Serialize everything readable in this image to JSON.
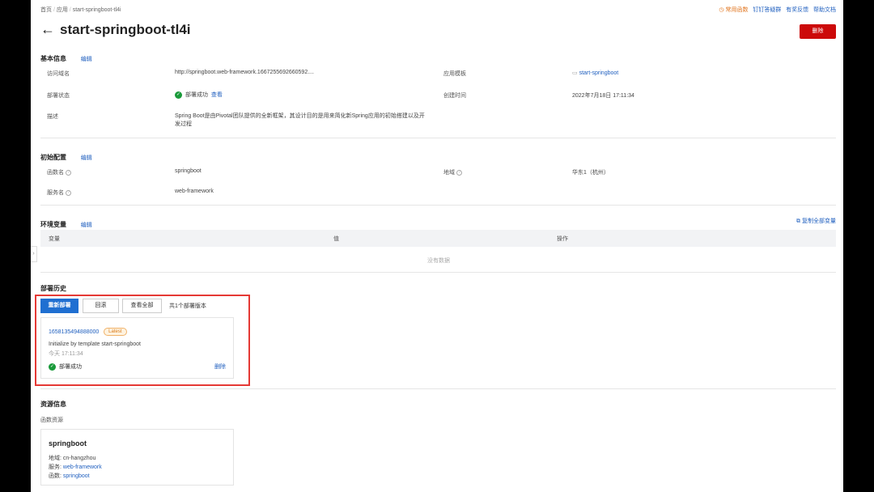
{
  "breadcrumb": [
    "首页",
    "应用",
    "start-springboot-tl4i"
  ],
  "toplinks": {
    "common_functions": "常用函数",
    "dingtalk": "钉钉答疑群",
    "feedback": "有奖反馈",
    "help": "帮助文档"
  },
  "header": {
    "title": "start-springboot-tl4i",
    "delete_label": "删除"
  },
  "basic": {
    "title": "基本信息",
    "edit": "编辑",
    "domain_label": "访问域名",
    "domain_value": "http://springboot.web-framework.1667255692660592....",
    "template_label": "应用模板",
    "template_value": "start-springboot",
    "status_label": "部署状态",
    "status_value": "部署成功",
    "status_view": "查看",
    "created_label": "创建时间",
    "created_value": "2022年7月18日 17:11:34",
    "desc_label": "描述",
    "desc_line1": "Spring Boot是由Pivotal团队提供的全新框架，其设计目的是用来简化新Spring应用的初始搭建以及开",
    "desc_line2": "发过程"
  },
  "init": {
    "title": "初始配置",
    "edit": "编辑",
    "func_label": "函数名",
    "func_value": "springboot",
    "region_label": "地域",
    "region_value": "华东1（杭州）",
    "service_label": "服务名",
    "service_value": "web-framework"
  },
  "env": {
    "title": "环境变量",
    "edit": "编辑",
    "copy_all": "复制全部变量",
    "col_var": "变量",
    "col_value": "值",
    "col_action": "操作",
    "empty": "没有数据"
  },
  "deploy": {
    "title": "部署历史",
    "redeploy": "重新部署",
    "rollback": "回滚",
    "view_all": "查看全部",
    "count_text": "共1个部署版本",
    "item_id": "1658135494888000",
    "item_tag": "Latest",
    "item_desc": "Initialize by template start-springboot",
    "item_time": "今天 17:11:34",
    "item_status": "部署成功",
    "item_delete": "删除"
  },
  "resource": {
    "title": "资源信息",
    "subtitle": "函数资源",
    "card_title": "springboot",
    "region_label": "地域:",
    "region_value": "cn-hangzhou",
    "service_label": "服务:",
    "service_value": "web-framework",
    "function_label": "函数:",
    "function_value": "springboot"
  }
}
